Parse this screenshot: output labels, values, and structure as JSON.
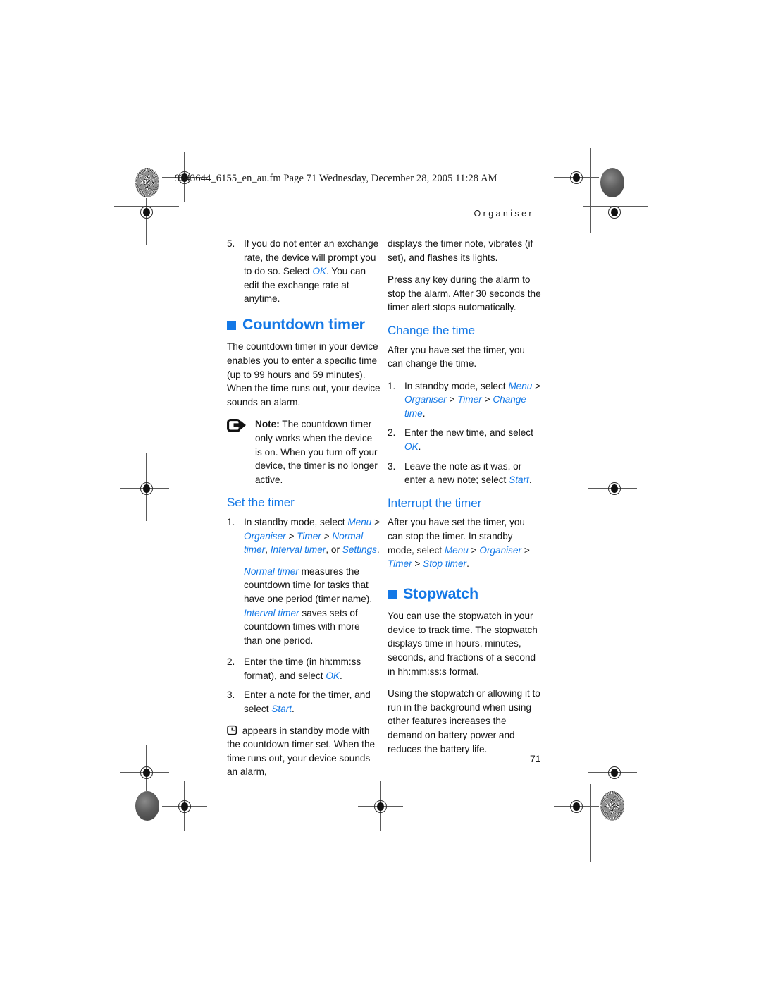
{
  "header": {
    "filename_line": "9243644_6155_en_au.fm  Page 71  Wednesday, December 28, 2005  11:28 AM",
    "running_head": "Organiser"
  },
  "page_number": "71",
  "colors": {
    "accent_blue": "#1478e6",
    "body_text": "#141414"
  },
  "left_column": {
    "step5": {
      "num": "5.",
      "text_a": "If you do not enter an exchange rate, the device will prompt you to do so. Select ",
      "link": "OK",
      "text_b": ". You can edit the exchange rate at anytime."
    },
    "countdown_heading": "Countdown timer",
    "countdown_intro": "The countdown timer in your device enables you to enter a specific time (up to 99 hours and 59 minutes). When the time runs out, your device sounds an alarm.",
    "note": {
      "label": "Note:",
      "text": " The countdown timer only works when the device is on. When you turn off your device, the timer is no longer active."
    },
    "set_timer_heading": "Set the timer",
    "set_step1": {
      "num": "1.",
      "lead": "In standby mode, select ",
      "path1": "Menu",
      "gt1": " > ",
      "path2": "Organiser",
      "gt2": " > ",
      "path3": "Timer",
      "gt3": " > ",
      "path4": "Normal timer",
      "comma": ", ",
      "path5": "Interval timer",
      "or": ", or ",
      "path6": "Settings",
      "period": "."
    },
    "set_step1_note": {
      "term1": "Normal timer",
      "body1": " measures the countdown time for tasks that have one period (timer name). ",
      "term2": "Interval timer",
      "body2": " saves sets of countdown times with more than one period."
    },
    "set_step2": {
      "num": "2.",
      "lead": "Enter the time (in hh:mm:ss format), and select ",
      "link": "OK",
      "tail": "."
    },
    "set_step3": {
      "num": "3.",
      "lead": "Enter a note for the timer, and select ",
      "link": "Start",
      "tail": "."
    },
    "icon_para": " appears in standby mode with the countdown timer set. When the time runs out, your device sounds an alarm,"
  },
  "right_column": {
    "cont_para1": "displays the timer note, vibrates (if set), and flashes its lights.",
    "cont_para2": "Press any key during the alarm to stop the alarm. After 30 seconds the timer alert stops automatically.",
    "change_heading": "Change the time",
    "change_intro": "After you have set the timer, you can change the time.",
    "change_step1": {
      "num": "1.",
      "lead": "In standby mode, select ",
      "path1": "Menu",
      "gt1": " > ",
      "path2": "Organiser",
      "gt2": " > ",
      "path3": "Timer",
      "gt3": " > ",
      "path4": "Change time",
      "period": "."
    },
    "change_step2": {
      "num": "2.",
      "lead": "Enter the new time, and select ",
      "link": "OK",
      "tail": "."
    },
    "change_step3": {
      "num": "3.",
      "lead": "Leave the note as it was, or enter a new note; select ",
      "link": "Start",
      "tail": "."
    },
    "interrupt_heading": "Interrupt the timer",
    "interrupt_body": {
      "lead": "After you have set the timer, you can stop the timer. In standby mode, select ",
      "path1": "Menu",
      "gt1": " > ",
      "path2": "Organiser",
      "gt2": " > ",
      "path3": "Timer",
      "gt3": " > ",
      "path4": "Stop timer",
      "period": "."
    },
    "stopwatch_heading": "Stopwatch",
    "stopwatch_para1": "You can use the stopwatch in your device to track time. The stopwatch displays time in hours, minutes, seconds, and fractions of a second in hh:mm:ss:s format.",
    "stopwatch_para2": "Using the stopwatch or allowing it to run in the background when using other features increases the demand on battery power and reduces the battery life."
  },
  "icons": {
    "note_icon": "note-arrow-icon",
    "countdown_icon": "countdown-timer-clock-icon"
  }
}
